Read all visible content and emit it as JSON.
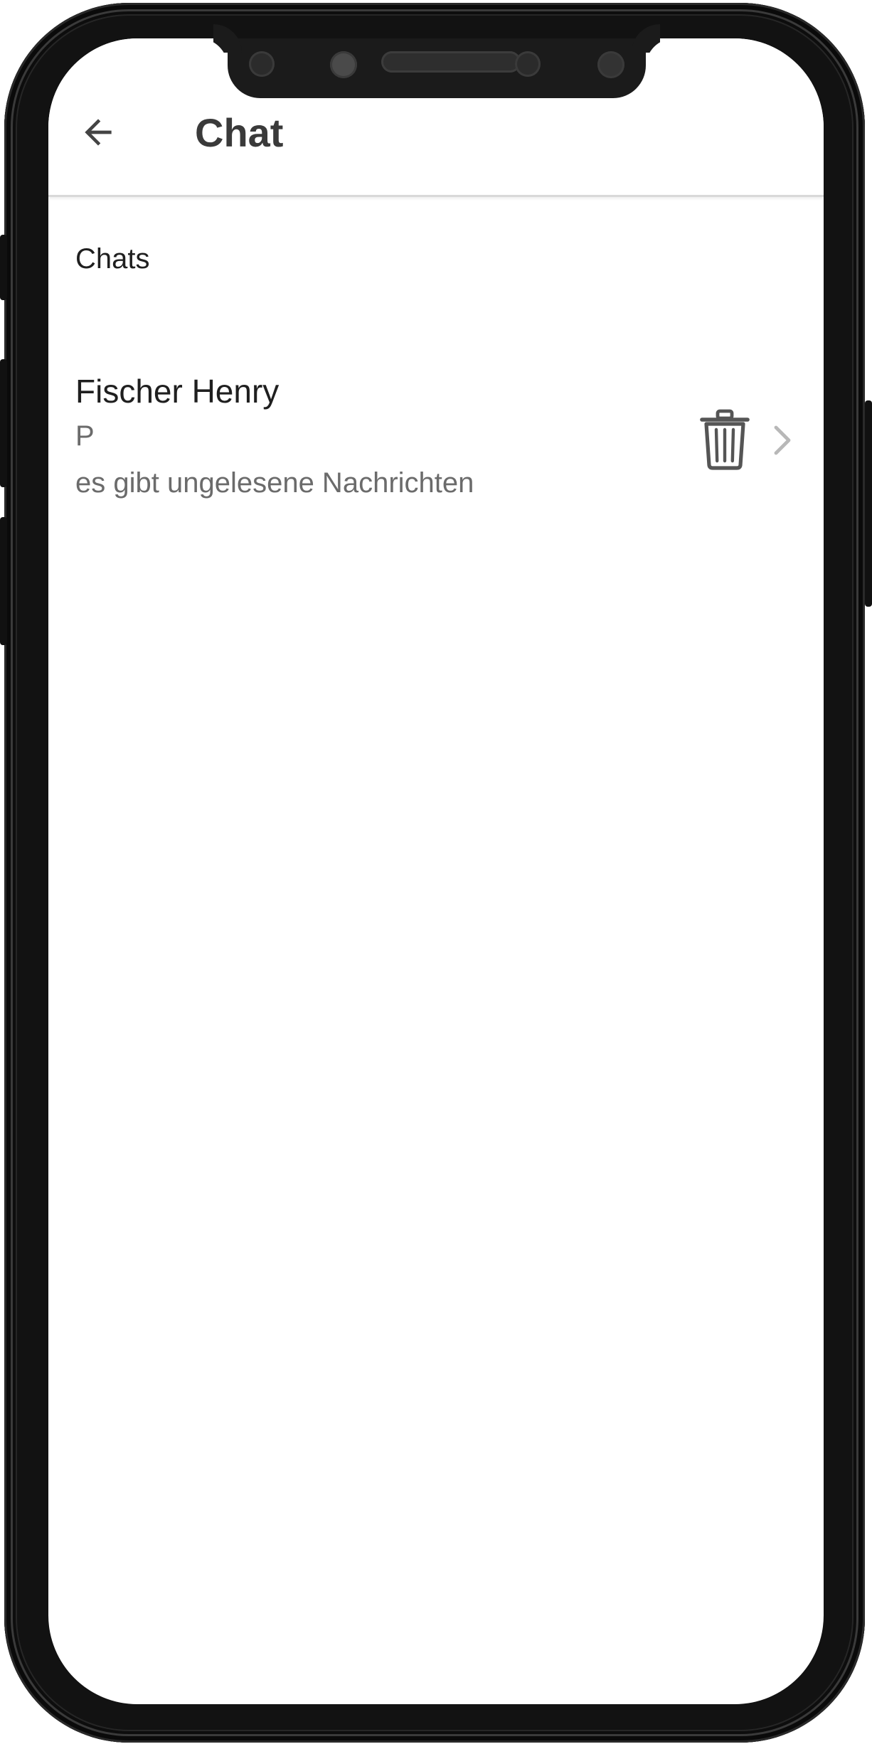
{
  "header": {
    "title": "Chat",
    "back_icon": "arrow-left-icon"
  },
  "section": {
    "title": "Chats"
  },
  "chats": [
    {
      "name": "Fischer Henry",
      "subtitle": "P",
      "status": "es gibt ungelesene Nachrichten",
      "delete_icon": "trash-icon",
      "chevron_icon": "chevron-right-icon"
    }
  ],
  "colors": {
    "title": "#3a3a3a",
    "text_primary": "#1f1f1f",
    "text_secondary": "#6b6b6b",
    "icon": "#555555",
    "chevron": "#b8b8b8",
    "frame": "#0d0d0d"
  }
}
